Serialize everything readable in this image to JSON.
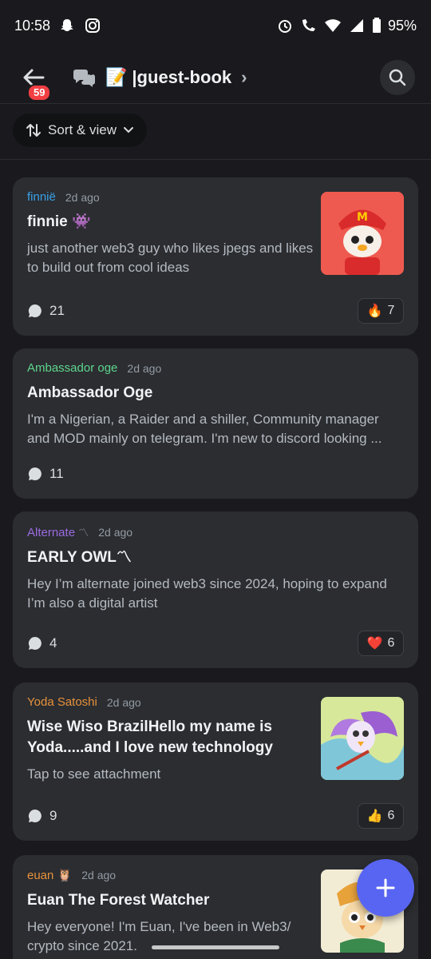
{
  "status_bar": {
    "time": "10:58",
    "battery": "95%"
  },
  "header": {
    "badge_count": "59",
    "channel_emoji": "📝",
    "channel_name": "|guest-book"
  },
  "sort": {
    "label": "Sort & view"
  },
  "posts": [
    {
      "author": "finnië",
      "author_color": "#3ba0e6",
      "time": "2d ago",
      "title": "finnie 👾",
      "body": "just another web3 guy who likes jpegs  and likes to build out from cool ideas",
      "comments": "21",
      "reaction_emoji": "🔥",
      "reaction_count": "7",
      "thumb_icon": "mcd-duck-avatar-image"
    },
    {
      "author": "Ambassador oge",
      "author_color": "#5fd68d",
      "time": "2d ago",
      "title": "Ambassador Oge",
      "body": "I'm a Nigerian, a Raider and a shiller, Community manager and MOD mainly on telegram. I'm new to discord looking ...",
      "comments": "11"
    },
    {
      "author": "Alternate",
      "author_suffix": "〽",
      "author_color": "#9b6bdf",
      "time": "2d ago",
      "title": "EARLY OWL〽",
      "body": "Hey I’m alternate joined web3 since 2024, hoping to expand I’m also a digital artist",
      "comments": "4",
      "reaction_emoji": "❤️",
      "reaction_count": "6"
    },
    {
      "author": "Yoda Satoshi",
      "author_color": "#e8913a",
      "time": "2d ago",
      "title": "Wise Wiso  BrazilHello my name is Yoda.....and I love new technology",
      "body": "Tap to see attachment",
      "comments": "9",
      "reaction_emoji": "👍",
      "reaction_count": "6",
      "thumb_icon": "winged-owl-artwork-image"
    },
    {
      "author": "euan",
      "author_suffix": "🦉",
      "author_color": "#e8913a",
      "time": "2d ago",
      "title": "Euan The Forest Watcher",
      "body": "Hey everyone! I'm Euan, I've been in Web3/ crypto since 2021.",
      "thumb_icon": "owl-avatar-image"
    }
  ],
  "colors": {
    "background": "#1a1a1e",
    "card": "#2b2d31",
    "accent": "#5865f2",
    "badge": "#f23f43"
  }
}
